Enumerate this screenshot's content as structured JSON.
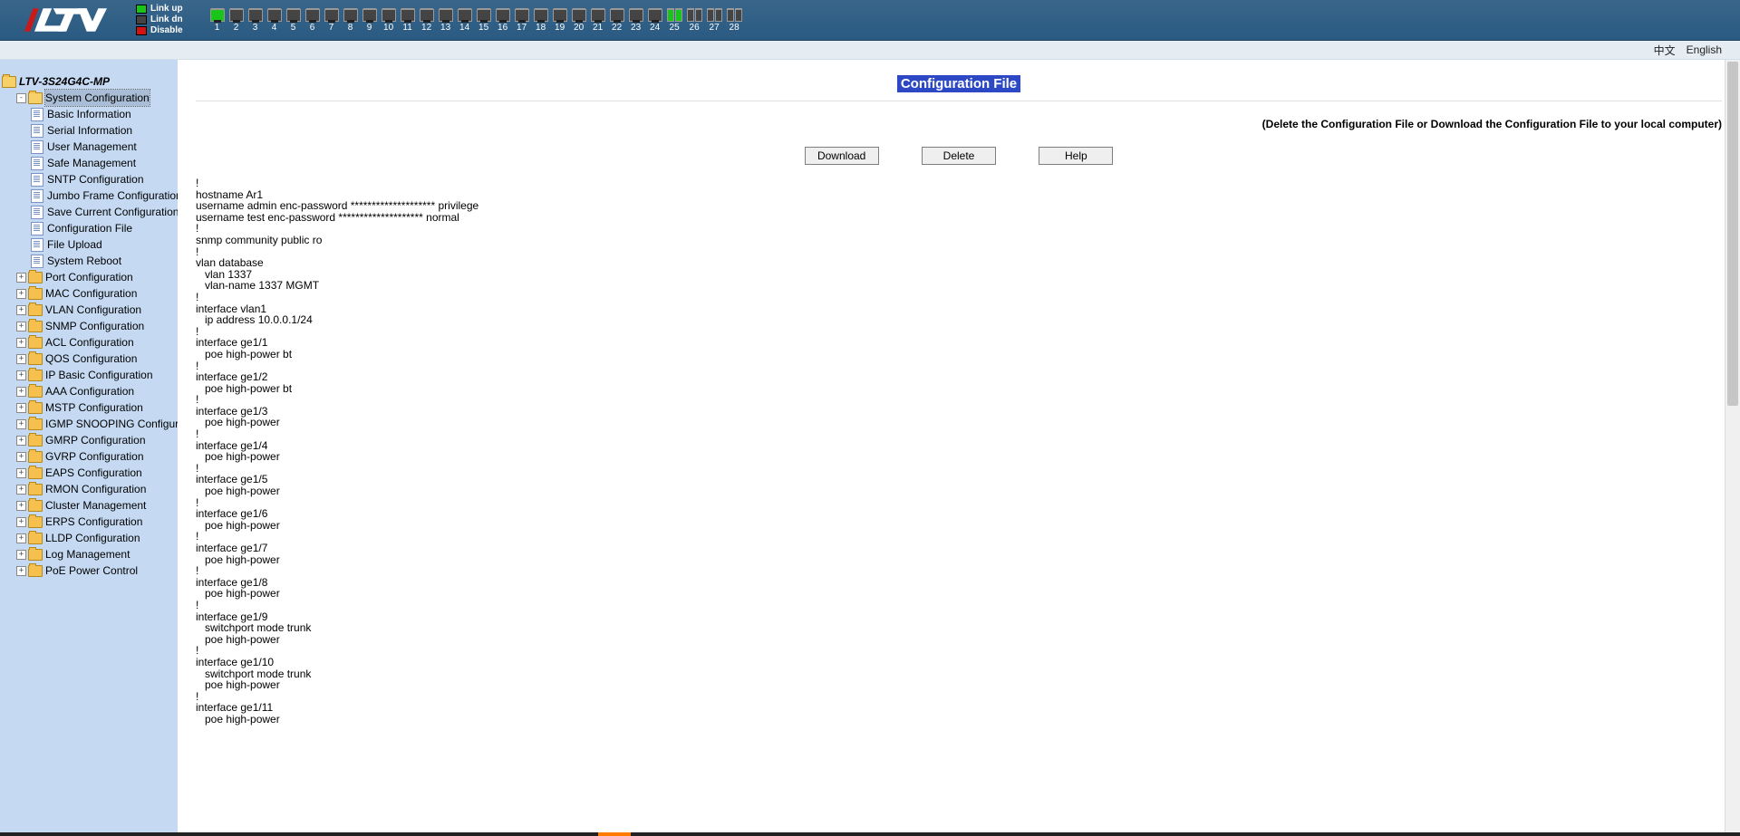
{
  "header": {
    "logo_letters": "LTV",
    "legend": {
      "up": "Link up",
      "down": "Link dn",
      "disable": "Disable"
    },
    "ports": [
      {
        "num": "1",
        "up": true
      },
      {
        "num": "2",
        "up": false
      },
      {
        "num": "3",
        "up": false
      },
      {
        "num": "4",
        "up": false
      },
      {
        "num": "5",
        "up": false
      },
      {
        "num": "6",
        "up": false
      },
      {
        "num": "7",
        "up": false
      },
      {
        "num": "8",
        "up": false
      },
      {
        "num": "9",
        "up": false
      },
      {
        "num": "10",
        "up": false
      },
      {
        "num": "11",
        "up": false
      },
      {
        "num": "12",
        "up": false
      },
      {
        "num": "13",
        "up": false
      },
      {
        "num": "14",
        "up": false
      },
      {
        "num": "15",
        "up": false
      },
      {
        "num": "16",
        "up": false
      },
      {
        "num": "17",
        "up": false
      },
      {
        "num": "18",
        "up": false
      },
      {
        "num": "19",
        "up": false
      },
      {
        "num": "20",
        "up": false
      },
      {
        "num": "21",
        "up": false
      },
      {
        "num": "22",
        "up": false
      },
      {
        "num": "23",
        "up": false
      },
      {
        "num": "24",
        "up": false
      }
    ],
    "port_pairs": [
      {
        "num": "25",
        "left": true,
        "right": true
      },
      {
        "num": "26",
        "left": false,
        "right": false
      },
      {
        "num": "27",
        "left": false,
        "right": false
      },
      {
        "num": "28",
        "left": false,
        "right": false
      }
    ]
  },
  "lang": {
    "zh": "中文",
    "en": "English"
  },
  "tree": {
    "root": "LTV-3S24G4C-MP",
    "sysconf": {
      "label": "System Configuration",
      "children": {
        "basic": "Basic Information",
        "serial": "Serial Information",
        "user": "User Management",
        "safe": "Safe Management",
        "sntp": "SNTP Configuration",
        "jumbo": "Jumbo Frame Configuration",
        "save": "Save Current Configuration",
        "cfgfile": "Configuration File",
        "upload": "File Upload",
        "reboot": "System Reboot"
      }
    },
    "folders": {
      "port": "Port Configuration",
      "mac": "MAC Configuration",
      "vlan": "VLAN Configuration",
      "snmp": "SNMP Configuration",
      "acl": "ACL Configuration",
      "qos": "QOS Configuration",
      "ip": "IP Basic Configuration",
      "aaa": "AAA Configuration",
      "mstp": "MSTP Configuration",
      "igmp": "IGMP SNOOPING Configuration",
      "gmrp": "GMRP Configuration",
      "gvrp": "GVRP Configuration",
      "eaps": "EAPS Configuration",
      "rmon": "RMON Configuration",
      "cluster": "Cluster Management",
      "erps": "ERPS Configuration",
      "lldp": "LLDP Configuration",
      "log": "Log Management",
      "poe": "PoE Power Control"
    }
  },
  "content": {
    "title": "Configuration File",
    "note": "(Delete the Configuration File or Download the Configuration File to your local computer)",
    "buttons": {
      "download": "Download",
      "delete": "Delete",
      "help": "Help"
    },
    "config_text": "!\nhostname Ar1\nusername admin enc-password ******************** privilege\nusername test enc-password ******************** normal\n!\nsnmp community public ro\n!\nvlan database\n   vlan 1337\n   vlan-name 1337 MGMT\n!\ninterface vlan1\n   ip address 10.0.0.1/24\n!\ninterface ge1/1\n   poe high-power bt\n!\ninterface ge1/2\n   poe high-power bt\n!\ninterface ge1/3\n   poe high-power\n!\ninterface ge1/4\n   poe high-power\n!\ninterface ge1/5\n   poe high-power\n!\ninterface ge1/6\n   poe high-power\n!\ninterface ge1/7\n   poe high-power\n!\ninterface ge1/8\n   poe high-power\n!\ninterface ge1/9\n   switchport mode trunk\n   poe high-power\n!\ninterface ge1/10\n   switchport mode trunk\n   poe high-power\n!\ninterface ge1/11\n   poe high-power"
  }
}
